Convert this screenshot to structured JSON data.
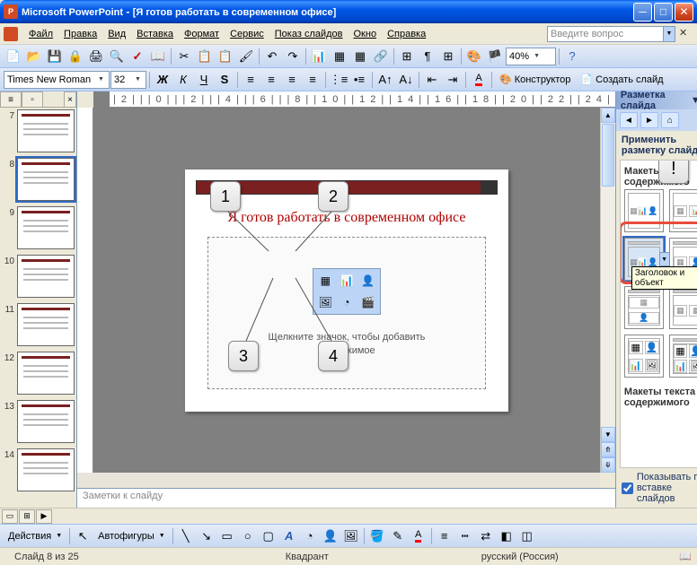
{
  "titlebar": {
    "app_name": "Microsoft PowerPoint",
    "doc_title": "[Я готов работать в современном офисе]"
  },
  "menubar": {
    "items": [
      "Файл",
      "Правка",
      "Вид",
      "Вставка",
      "Формат",
      "Сервис",
      "Показ слайдов",
      "Окно",
      "Справка"
    ],
    "help_placeholder": "Введите вопрос"
  },
  "toolbar1": {
    "zoom": "40%"
  },
  "toolbar2": {
    "font": "Times New Roman",
    "size": "32",
    "designer_label": "Конструктор",
    "new_slide_label": "Создать слайд"
  },
  "thumbs": {
    "start": 7,
    "count": 8,
    "selected": 8
  },
  "slide": {
    "title": "Я готов работать в современном офисе",
    "hint_line1": "Щелкните значок, чтобы добавить",
    "hint_line2": "содержимое",
    "callouts": [
      "1",
      "2",
      "3",
      "4"
    ]
  },
  "notes": {
    "placeholder": "Заметки к слайду"
  },
  "taskpane": {
    "title": "Разметка слайда",
    "apply_label": "Применить разметку слайда:",
    "section1": "Макеты содержимого",
    "section2_line1": "Макеты текста и",
    "section2_line2": "содержимого",
    "tooltip": "Заголовок и объект",
    "callout_alert": "!",
    "show_on_insert": "Показывать при вставке слайдов"
  },
  "draw_toolbar": {
    "actions_label": "Действия",
    "autoshapes_label": "Автофигуры"
  },
  "statusbar": {
    "slide_info": "Слайд 8 из 25",
    "design": "Квадрант",
    "language": "русский (Россия)"
  },
  "colors": {
    "accent": "#316ac5",
    "callout_red": "#e74c3c"
  }
}
